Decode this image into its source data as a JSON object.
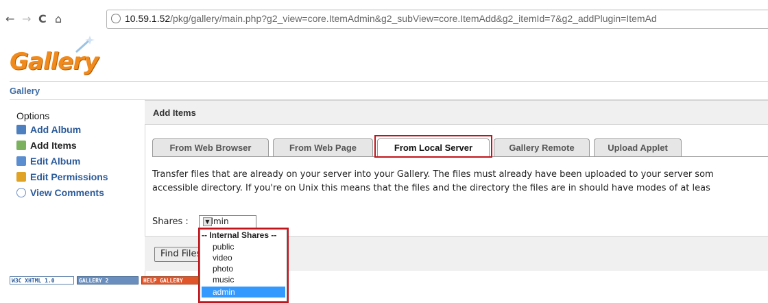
{
  "browser": {
    "url_host": "10.59.1.52",
    "url_path": "/pkg/gallery/main.php?g2_view=core.ItemAdmin&g2_subView=core.ItemAdd&g2_itemId=7&g2_addPlugin=ItemAd"
  },
  "header": {
    "logo_text": "Gallery",
    "breadcrumb": "Gallery"
  },
  "sidebar": {
    "title": "Options",
    "items": [
      {
        "label": "Add Album",
        "icon": "album-add-icon",
        "color": "#4e7fbf"
      },
      {
        "label": "Add Items",
        "icon": "items-add-icon",
        "color": "#7bb15f"
      },
      {
        "label": "Edit Album",
        "icon": "edit-album-icon",
        "color": "#5b8ed1"
      },
      {
        "label": "Edit Permissions",
        "icon": "permissions-icon",
        "color": "#e0a326"
      },
      {
        "label": "View Comments",
        "icon": "comments-icon",
        "color": "#6c8fc7"
      }
    ]
  },
  "main": {
    "title": "Add Items",
    "tabs": [
      {
        "label": "From Web Browser"
      },
      {
        "label": "From Web Page"
      },
      {
        "label": "From Local Server"
      },
      {
        "label": "Gallery Remote"
      },
      {
        "label": "Upload Applet"
      }
    ],
    "description_line1": "Transfer files that are already on your server into your Gallery. The files must already have been uploaded to your server som",
    "description_line2": "accessible directory. If you're on Unix this means that the files and the directory the files are in should have modes of at leas",
    "shares_label": "Shares :",
    "shares_value": "admin",
    "find_button": "Find Files"
  },
  "dropdown": {
    "group": "-- Internal Shares --",
    "options": [
      "public",
      "video",
      "photo",
      "music",
      "admin"
    ],
    "selected": "admin"
  },
  "footer_badges": [
    {
      "label": "W3C XHTML 1.0"
    },
    {
      "label": "GALLERY 2"
    },
    {
      "label": "HELP GALLERY"
    }
  ],
  "colors": {
    "highlight": "#c0141c",
    "link": "#2a5a9a",
    "selection": "#3399ff"
  }
}
